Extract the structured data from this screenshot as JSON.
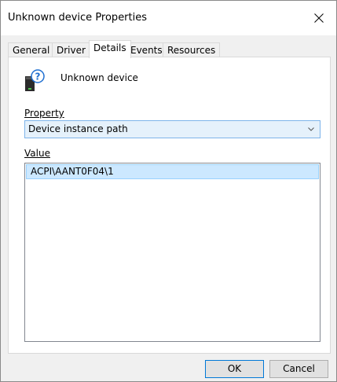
{
  "window": {
    "title": "Unknown device Properties"
  },
  "tabs": [
    {
      "label": "General"
    },
    {
      "label": "Driver"
    },
    {
      "label": "Details"
    },
    {
      "label": "Events"
    },
    {
      "label": "Resources"
    }
  ],
  "active_tab": "Details",
  "device": {
    "name": "Unknown device",
    "icon": "unknown-device-icon"
  },
  "property": {
    "label": "Property",
    "selected": "Device instance path"
  },
  "value": {
    "label": "Value",
    "items": [
      "ACPI\\AANT0F04\\1"
    ]
  },
  "buttons": {
    "ok": "OK",
    "cancel": "Cancel"
  },
  "colors": {
    "selection": "#cce8ff",
    "select_focus_border": "#7eb4ea",
    "default_button_border": "#0078d7"
  }
}
